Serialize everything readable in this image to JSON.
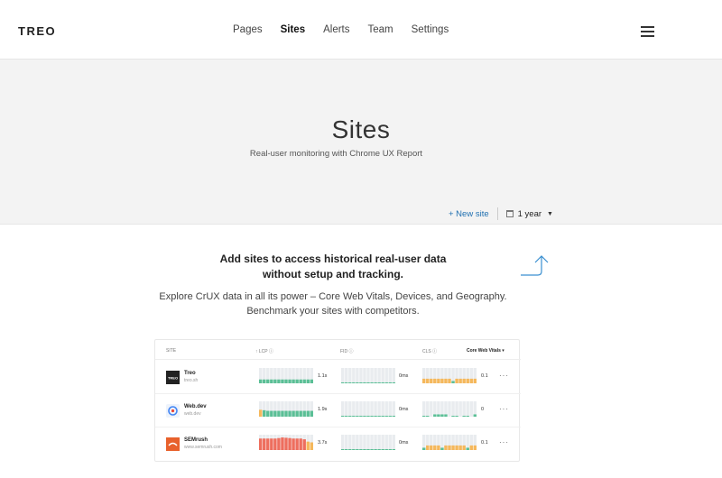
{
  "app": {
    "logo": "TREO"
  },
  "nav": {
    "items": [
      {
        "label": "Pages",
        "active": false
      },
      {
        "label": "Sites",
        "active": true
      },
      {
        "label": "Alerts",
        "active": false
      },
      {
        "label": "Team",
        "active": false
      },
      {
        "label": "Settings",
        "active": false
      }
    ]
  },
  "hero": {
    "title": "Sites",
    "subtitle": "Real-user monitoring with Chrome UX Report",
    "new_site_label": "+ New site",
    "period_label": "1 year",
    "period_caret": "▼"
  },
  "promo": {
    "title_line1": "Add sites to access historical real-user data",
    "title_line2": "without setup and tracking.",
    "desc_line1": "Explore CrUX data in all its power – Core Web Vitals, Devices, and Geography.",
    "desc_line2": "Benchmark your sites with competitors."
  },
  "preview_table": {
    "headers": {
      "site": "SITE",
      "lcp": "↑ LCP ⓘ",
      "fid": "FID ⓘ",
      "cls": "CLS ⓘ",
      "cwv": "Core Web Vitals ▾"
    },
    "colors": {
      "good": "#5bbf96",
      "needs": "#f5b85c",
      "poor": "#ee6e5e",
      "empty": "#e9ecef"
    },
    "rows": [
      {
        "name": "Treo",
        "url": "treo.sh",
        "icon": "treo-logo-icon",
        "lcp": {
          "value": "1.1",
          "unit": "s",
          "bars": [
            [
              "g",
              0.25
            ],
            [
              "g",
              0.25
            ],
            [
              "g",
              0.25
            ],
            [
              "g",
              0.25
            ],
            [
              "g",
              0.25
            ],
            [
              "g",
              0.25
            ],
            [
              "g",
              0.25
            ],
            [
              "g",
              0.25
            ],
            [
              "g",
              0.25
            ],
            [
              "g",
              0.25
            ],
            [
              "g",
              0.25
            ],
            [
              "g",
              0.25
            ],
            [
              "g",
              0.25
            ],
            [
              "g",
              0.25
            ],
            [
              "g",
              0.25
            ]
          ]
        },
        "fid": {
          "value": "0",
          "unit": "ms",
          "bars": [
            [
              "g",
              0.06
            ],
            [
              "g",
              0.06
            ],
            [
              "g",
              0.06
            ],
            [
              "g",
              0.06
            ],
            [
              "g",
              0.06
            ],
            [
              "g",
              0.06
            ],
            [
              "g",
              0.06
            ],
            [
              "g",
              0.06
            ],
            [
              "g",
              0.06
            ],
            [
              "g",
              0.06
            ],
            [
              "g",
              0.06
            ],
            [
              "g",
              0.06
            ],
            [
              "g",
              0.06
            ],
            [
              "g",
              0.06
            ],
            [
              "g",
              0.06
            ]
          ]
        },
        "cls": {
          "value": "0.1",
          "unit": "",
          "bars": [
            [
              "n",
              0.3
            ],
            [
              "n",
              0.3
            ],
            [
              "n",
              0.3
            ],
            [
              "n",
              0.3
            ],
            [
              "n",
              0.3
            ],
            [
              "n",
              0.3
            ],
            [
              "n",
              0.3
            ],
            [
              "n",
              0.3
            ],
            [
              "g",
              0.15
            ],
            [
              "n",
              0.3
            ],
            [
              "n",
              0.3
            ],
            [
              "n",
              0.3
            ],
            [
              "n",
              0.3
            ],
            [
              "n",
              0.3
            ],
            [
              "n",
              0.3
            ]
          ]
        }
      },
      {
        "name": "Web.dev",
        "url": "web.dev",
        "icon": "webdev-logo-icon",
        "lcp": {
          "value": "1.9",
          "unit": "s",
          "bars": [
            [
              "n",
              0.45
            ],
            [
              "g",
              0.42
            ],
            [
              "g",
              0.38
            ],
            [
              "g",
              0.38
            ],
            [
              "g",
              0.38
            ],
            [
              "g",
              0.38
            ],
            [
              "g",
              0.38
            ],
            [
              "g",
              0.38
            ],
            [
              "g",
              0.38
            ],
            [
              "g",
              0.38
            ],
            [
              "g",
              0.38
            ],
            [
              "g",
              0.38
            ],
            [
              "g",
              0.38
            ],
            [
              "g",
              0.38
            ],
            [
              "g",
              0.38
            ]
          ]
        },
        "fid": {
          "value": "0",
          "unit": "ms",
          "bars": [
            [
              "g",
              0.06
            ],
            [
              "g",
              0.06
            ],
            [
              "g",
              0.06
            ],
            [
              "g",
              0.06
            ],
            [
              "g",
              0.06
            ],
            [
              "g",
              0.06
            ],
            [
              "g",
              0.06
            ],
            [
              "g",
              0.06
            ],
            [
              "g",
              0.06
            ],
            [
              "g",
              0.06
            ],
            [
              "g",
              0.06
            ],
            [
              "g",
              0.06
            ],
            [
              "g",
              0.06
            ],
            [
              "g",
              0.06
            ],
            [
              "g",
              0.06
            ]
          ]
        },
        "cls": {
          "value": "0",
          "unit": "",
          "bars": [
            [
              "g",
              0.06
            ],
            [
              "g",
              0.06
            ],
            [
              "e",
              0.0
            ],
            [
              "g",
              0.15
            ],
            [
              "g",
              0.15
            ],
            [
              "g",
              0.15
            ],
            [
              "g",
              0.15
            ],
            [
              "e",
              0.0
            ],
            [
              "g",
              0.06
            ],
            [
              "g",
              0.06
            ],
            [
              "e",
              0.0
            ],
            [
              "g",
              0.06
            ],
            [
              "g",
              0.06
            ],
            [
              "e",
              0.0
            ],
            [
              "g",
              0.15
            ]
          ]
        }
      },
      {
        "name": "SEMrush",
        "url": "www.semrush.com",
        "icon": "semrush-logo-icon",
        "lcp": {
          "value": "3.7",
          "unit": "s",
          "bars": [
            [
              "p",
              0.75
            ],
            [
              "p",
              0.75
            ],
            [
              "p",
              0.75
            ],
            [
              "p",
              0.75
            ],
            [
              "p",
              0.75
            ],
            [
              "p",
              0.78
            ],
            [
              "p",
              0.82
            ],
            [
              "p",
              0.8
            ],
            [
              "p",
              0.78
            ],
            [
              "p",
              0.75
            ],
            [
              "p",
              0.75
            ],
            [
              "p",
              0.75
            ],
            [
              "p",
              0.7
            ],
            [
              "n",
              0.55
            ],
            [
              "n",
              0.5
            ]
          ]
        },
        "fid": {
          "value": "0",
          "unit": "ms",
          "bars": [
            [
              "g",
              0.06
            ],
            [
              "g",
              0.06
            ],
            [
              "g",
              0.06
            ],
            [
              "g",
              0.06
            ],
            [
              "g",
              0.06
            ],
            [
              "g",
              0.06
            ],
            [
              "g",
              0.06
            ],
            [
              "g",
              0.06
            ],
            [
              "g",
              0.06
            ],
            [
              "g",
              0.06
            ],
            [
              "g",
              0.06
            ],
            [
              "g",
              0.06
            ],
            [
              "g",
              0.06
            ],
            [
              "g",
              0.06
            ],
            [
              "g",
              0.06
            ]
          ]
        },
        "cls": {
          "value": "0.1",
          "unit": "",
          "bars": [
            [
              "g",
              0.15
            ],
            [
              "n",
              0.3
            ],
            [
              "n",
              0.3
            ],
            [
              "n",
              0.3
            ],
            [
              "n",
              0.3
            ],
            [
              "g",
              0.15
            ],
            [
              "n",
              0.3
            ],
            [
              "n",
              0.3
            ],
            [
              "n",
              0.3
            ],
            [
              "n",
              0.3
            ],
            [
              "n",
              0.3
            ],
            [
              "n",
              0.3
            ],
            [
              "g",
              0.15
            ],
            [
              "n",
              0.3
            ],
            [
              "n",
              0.3
            ]
          ]
        }
      }
    ]
  }
}
